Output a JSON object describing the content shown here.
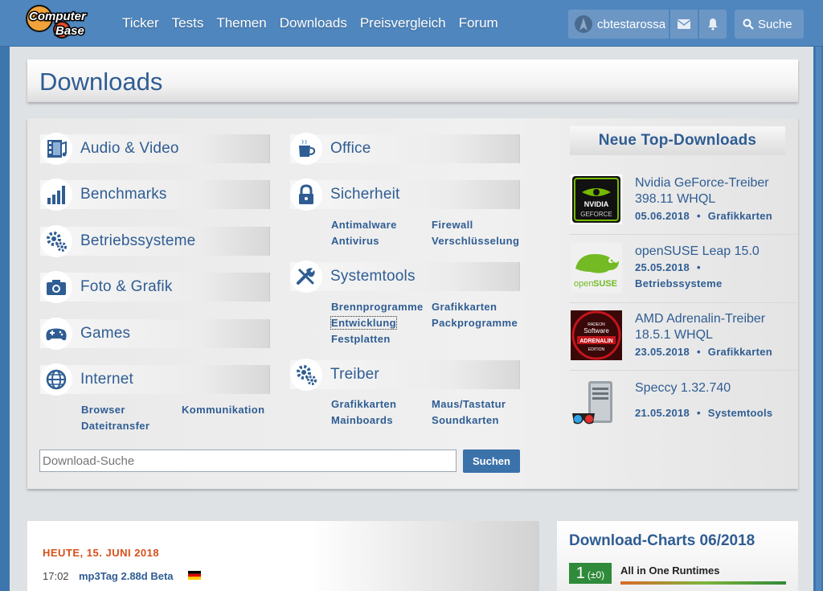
{
  "nav": {
    "items": [
      "Ticker",
      "Tests",
      "Themen",
      "Downloads",
      "Preisvergleich",
      "Forum"
    ],
    "user": "cbtestarossa",
    "search_label": "Suche"
  },
  "page_title": "Downloads",
  "categories": [
    {
      "label": "Audio & Video",
      "icon": "film-music-icon"
    },
    {
      "label": "Benchmarks",
      "icon": "bar-chart-icon"
    },
    {
      "label": "Betriebssysteme",
      "icon": "gears-icon"
    },
    {
      "label": "Foto & Grafik",
      "icon": "camera-icon"
    },
    {
      "label": "Games",
      "icon": "gamepad-icon"
    },
    {
      "label": "Internet",
      "icon": "globe-icon"
    },
    {
      "label": "Office",
      "icon": "mug-icon"
    },
    {
      "label": "Sicherheit",
      "icon": "lock-icon"
    },
    {
      "label": "Systemtools",
      "icon": "tools-icon"
    },
    {
      "label": "Treiber",
      "icon": "gears-icon"
    }
  ],
  "subcategories": {
    "internet": [
      "Browser",
      "Kommunikation",
      "Dateitransfer"
    ],
    "sicherheit": [
      "Antimalware",
      "Firewall",
      "Antivirus",
      "Verschlüsselung"
    ],
    "systemtools": [
      "Brennprogramme",
      "Grafikkarten",
      "Entwicklung",
      "Packprogramme",
      "Festplatten"
    ],
    "treiber": [
      "Grafikkarten",
      "Maus/Tastatur",
      "Mainboards",
      "Soundkarten"
    ]
  },
  "search": {
    "placeholder": "Download-Suche",
    "button": "Suchen"
  },
  "top_downloads": {
    "heading": "Neue Top-Downloads",
    "items": [
      {
        "name": "Nvidia GeForce-Treiber 398.11 WHQL",
        "date": "05.06.2018",
        "category": "Grafikkarten"
      },
      {
        "name": "openSUSE Leap 15.0",
        "date": "25.05.2018",
        "category": "Betriebssysteme"
      },
      {
        "name": "AMD Adrenalin-Treiber 18.5.1 WHQL",
        "date": "23.05.2018",
        "category": "Grafikkarten"
      },
      {
        "name": "Speccy 1.32.740",
        "date": "21.05.2018",
        "category": "Systemtools"
      }
    ],
    "separator": "•",
    "thumb_texts": {
      "nvidia_1": "NVIDIA",
      "nvidia_2": "GEFORCE",
      "opensuse_1": "open",
      "opensuse_2": "SUSE",
      "amd_1": "RADEON",
      "amd_2": "Software",
      "amd_3": "ADRENALIN",
      "amd_4": "EDITION"
    }
  },
  "news": {
    "date": "HEUTE, 15. JUNI 2018",
    "time": "17:02",
    "entry": "mp3Tag 2.88d Beta"
  },
  "charts": {
    "heading": "Download-Charts 06/2018",
    "rank": "1",
    "delta": "(±0)",
    "title": "All in One Runtimes"
  },
  "colors": {
    "nav_bg": "#4f86be",
    "link": "#2f5d93",
    "date_accent": "#d6501a",
    "chart_green": "#2f8a3a"
  }
}
